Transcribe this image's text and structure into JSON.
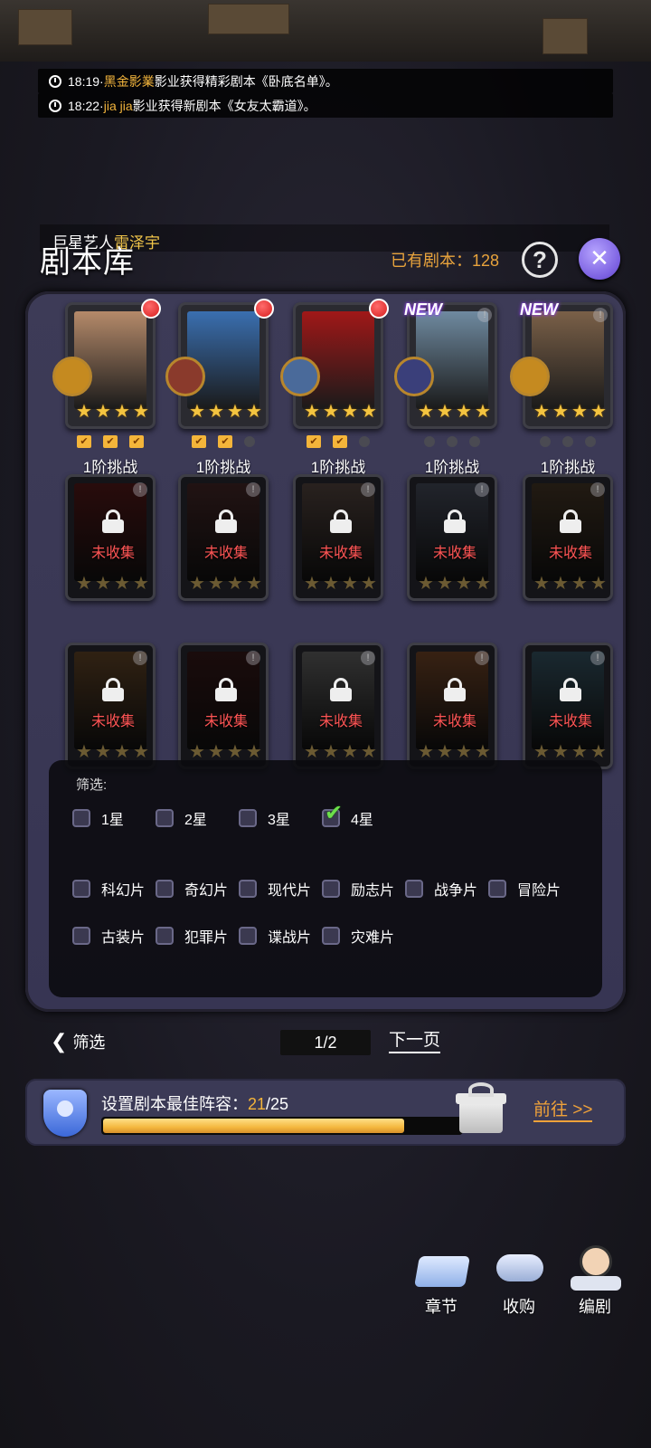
{
  "ticker": [
    {
      "time": "18:19",
      "sep": " · ",
      "name": "黑金影業",
      "text": "影业获得精彩剧本《卧底名单》。"
    },
    {
      "time": "18:22",
      "sep": " · ",
      "name": "jia jia",
      "text": "影业获得新剧本《女友太霸道》。"
    }
  ],
  "header": {
    "notice_prefix": "巨星艺人",
    "notice_name": "雷泽宇",
    "title": "剧本库",
    "owned_label": "已有剧本：",
    "owned_count": "128",
    "help_icon": "question-icon",
    "close_icon": "close-icon"
  },
  "cards_row1": [
    {
      "poster": "#b58a6a",
      "badge": "red-dot",
      "avatar": "#c58a20",
      "stars": 4,
      "progress": [
        true,
        true,
        true
      ],
      "stage": "1阶挑战"
    },
    {
      "poster": "#3a6fb0",
      "badge": "red-dot",
      "avatar": "#8a3a2c",
      "stars": 4,
      "progress": [
        true,
        true,
        false
      ],
      "stage": "1阶挑战"
    },
    {
      "poster": "#a01818",
      "badge": "red-dot",
      "avatar": "#4a6a9a",
      "stars": 4,
      "progress": [
        true,
        true,
        false
      ],
      "stage": "1阶挑战"
    },
    {
      "poster": "#6f8aa0",
      "badge": "NEW",
      "avatar": "#3a3f7a",
      "stars": 4,
      "progress": [
        false,
        false,
        false
      ],
      "stage": "1阶挑战"
    },
    {
      "poster": "#7a6048",
      "badge": "NEW",
      "avatar": "#c58a20",
      "stars": 4,
      "progress": [
        false,
        false,
        false
      ],
      "stage": "1阶挑战"
    }
  ],
  "cards_row2": [
    {
      "poster": "#5a1a1a",
      "label": "未收集",
      "stars": 4
    },
    {
      "poster": "#4a2a2a",
      "label": "未收集",
      "stars": 4
    },
    {
      "poster": "#5a4a44",
      "label": "未收集",
      "stars": 4
    },
    {
      "poster": "#4a5060",
      "label": "未收集",
      "stars": 4
    },
    {
      "poster": "#4a3a28",
      "label": "未收集",
      "stars": 4
    }
  ],
  "cards_row3": [
    {
      "poster": "#6a4a2a",
      "label": "未收集",
      "stars": 4
    },
    {
      "poster": "#3a1a1a",
      "label": "未收集",
      "stars": 4
    },
    {
      "poster": "#6a6a6a",
      "label": "未收集",
      "stars": 4
    },
    {
      "poster": "#7a4a2a",
      "label": "未收集",
      "stars": 4
    },
    {
      "poster": "#3a5a6a",
      "label": "未收集",
      "stars": 4
    }
  ],
  "filter": {
    "title": "筛选:",
    "stars": [
      {
        "label": "1星",
        "checked": false
      },
      {
        "label": "2星",
        "checked": false
      },
      {
        "label": "3星",
        "checked": false
      },
      {
        "label": "4星",
        "checked": true
      }
    ],
    "genres_row1": [
      "科幻片",
      "奇幻片",
      "现代片",
      "励志片",
      "战争片",
      "冒险片"
    ],
    "genres_row2": [
      "古装片",
      "犯罪片",
      "谍战片",
      "灾难片"
    ]
  },
  "pager": {
    "back_label": "筛选",
    "page": "1/2",
    "next_label": "下一页"
  },
  "lineup": {
    "label": "设置剧本最佳阵容：",
    "current": "21",
    "total": "/25",
    "progress_fraction": 0.84,
    "goto_label": "前往 >>"
  },
  "menu": [
    {
      "label": "章节",
      "icon": "book-icon"
    },
    {
      "label": "收购",
      "icon": "handshake-icon"
    },
    {
      "label": "编剧",
      "icon": "writer-icon"
    }
  ]
}
